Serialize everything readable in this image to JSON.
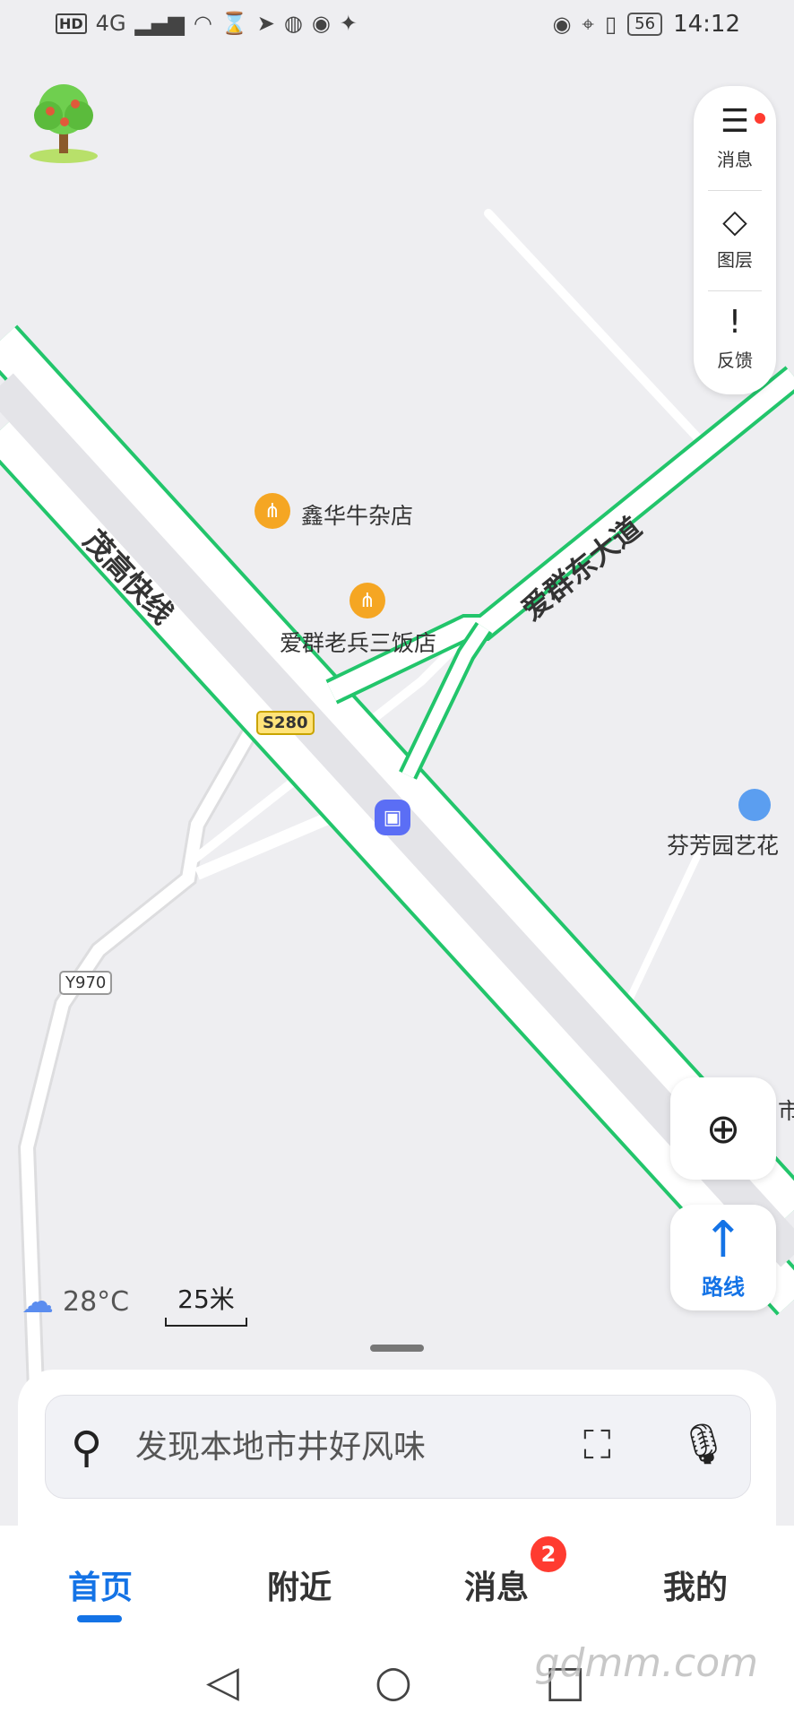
{
  "status_bar": {
    "network": "4G",
    "battery": "56",
    "time": "14:12"
  },
  "map": {
    "roads": {
      "expressway": "茂高快线",
      "avenue": "爱群东大道",
      "route_s": "S280",
      "route_y": "Y970"
    },
    "pois": [
      {
        "name": "鑫华牛杂店"
      },
      {
        "name": "爱群老兵三饭店"
      },
      {
        "name": "芬芳园艺花"
      },
      {
        "name": "市"
      }
    ],
    "weather": "28°C",
    "scale": "25米"
  },
  "tools": {
    "messages": "消息",
    "layers": "图层",
    "feedback": "反馈"
  },
  "route_button": "路线",
  "search": {
    "placeholder": "发现本地市井好风味"
  },
  "tabs": [
    {
      "label": "首页"
    },
    {
      "label": "附近"
    },
    {
      "label": "消息"
    },
    {
      "label": "我的"
    }
  ],
  "tab_badge": "2",
  "watermark": "gdmm.com",
  "colors": {
    "accent": "#1473e6",
    "road_green": "#22c56b",
    "badge_red": "#ff3b30"
  }
}
